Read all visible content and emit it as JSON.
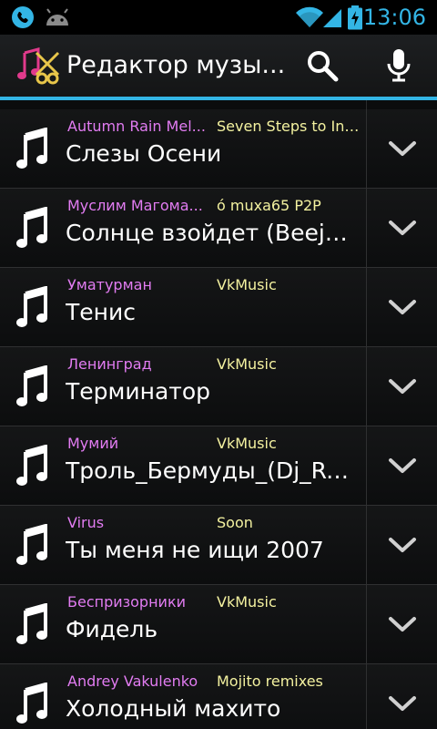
{
  "status_bar": {
    "time": "13:06",
    "icons": [
      "phone-icon",
      "android-icon",
      "wifi-icon",
      "signal-icon",
      "battery-charging-icon"
    ]
  },
  "action_bar": {
    "title": "Редактор музы...",
    "actions": [
      "search-icon",
      "microphone-icon"
    ]
  },
  "songs": [
    {
      "artist": "Autumn Rain Mel...",
      "album": "Seven Steps to Inf...",
      "title": "Слезы Осени"
    },
    {
      "artist": "Муслим Магома...",
      "album": "ó muxa65 P2P",
      "title": "Солнце взойдет (Beejo I..."
    },
    {
      "artist": "Уматурман",
      "album": "VkMusic",
      "title": "Тенис"
    },
    {
      "artist": "Ленинград",
      "album": "VkMusic",
      "title": "Терминатор"
    },
    {
      "artist": "Мумий",
      "album": "VkMusic",
      "title": "Троль_Бермуды_(Dj_RA..."
    },
    {
      "artist": "Virus",
      "album": "Soon",
      "title": "Ты меня не ищи 2007"
    },
    {
      "artist": "Беспризорники",
      "album": "VkMusic",
      "title": "Фидель"
    },
    {
      "artist": "Andrey Vakulenko",
      "album": "Mojito remixes",
      "title": "Холодный махито"
    }
  ],
  "colors": {
    "accent": "#33b5e5",
    "artist": "#e27cf2",
    "album": "#f4f2a0"
  }
}
